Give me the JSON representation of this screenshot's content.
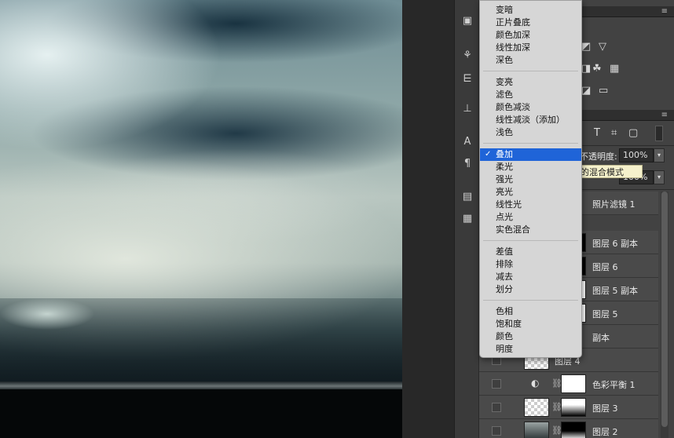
{
  "blend_menu": {
    "groups": [
      [
        "变暗",
        "正片叠底",
        "颜色加深",
        "线性加深",
        "深色"
      ],
      [
        "变亮",
        "滤色",
        "颜色减淡",
        "线性减淡（添加）",
        "浅色"
      ],
      [
        "叠加",
        "柔光",
        "强光",
        "亮光",
        "线性光",
        "点光",
        "实色混合"
      ],
      [
        "差值",
        "排除",
        "减去",
        "划分"
      ],
      [
        "色相",
        "饱和度",
        "颜色",
        "明度"
      ]
    ],
    "selected": "叠加",
    "check_mark": "✓"
  },
  "layers_panel": {
    "opacity_label": "不透明度:",
    "opacity_value": "100%",
    "fill_value": "100%",
    "tooltip": "的混合模式",
    "layers": [
      {
        "name": "照片滤镜 1",
        "type": "adjustment"
      },
      {
        "name": "图层 6 副本",
        "type": "masked"
      },
      {
        "name": "图层 6",
        "type": "masked"
      },
      {
        "name": "图层 5 副本",
        "type": "masked"
      },
      {
        "name": "图层 5",
        "type": "masked"
      },
      {
        "name": "副本",
        "type": "plain"
      },
      {
        "name": "图层 4",
        "type": "plain"
      },
      {
        "name": "色彩平衡 1",
        "type": "adjustment"
      },
      {
        "name": "图层 3",
        "type": "masked"
      },
      {
        "name": "图层 2",
        "type": "masked"
      }
    ]
  },
  "tools": {
    "text_tool": "A",
    "paragraph_tool": "¶"
  },
  "panel_type_icon": "T",
  "icons": {
    "panel_menu": "panel-menu-icon",
    "chain": "link-icon",
    "visibility": "eye-icon"
  },
  "colors": {
    "menu_selected": "#1f64d8",
    "tooltip_bg": "#f5f1cc"
  }
}
